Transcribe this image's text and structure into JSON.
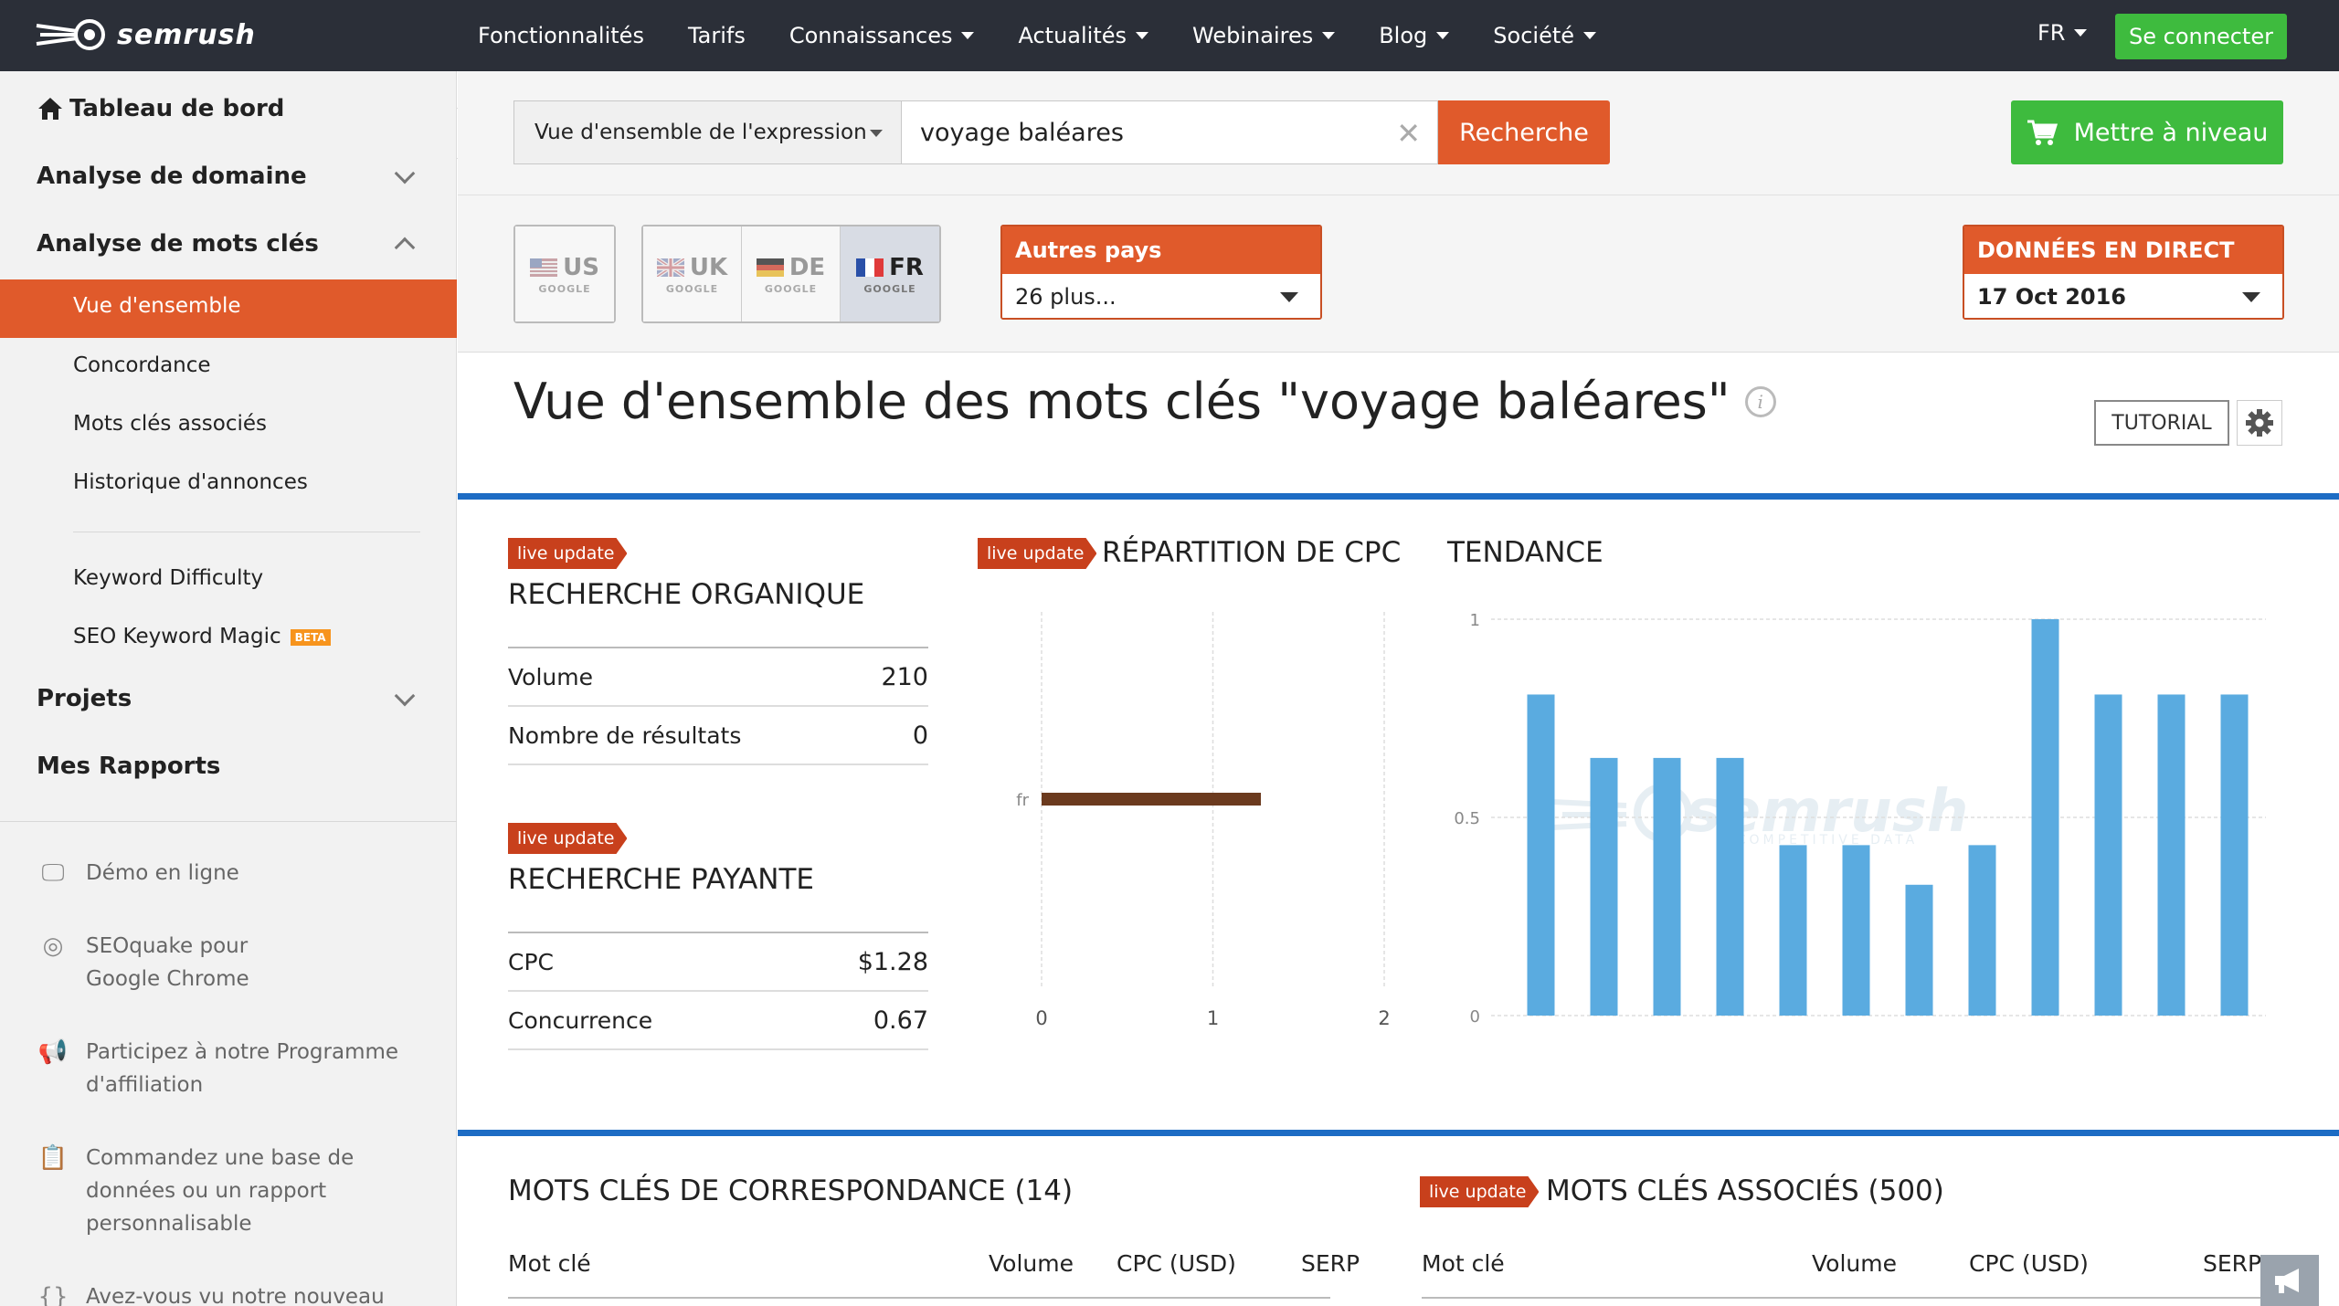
{
  "brand": {
    "name": "semrush"
  },
  "nav": {
    "items": [
      {
        "label": "Fonctionnalités",
        "dropdown": false
      },
      {
        "label": "Tarifs",
        "dropdown": false
      },
      {
        "label": "Connaissances",
        "dropdown": true
      },
      {
        "label": "Actualités",
        "dropdown": true
      },
      {
        "label": "Webinaires",
        "dropdown": true
      },
      {
        "label": "Blog",
        "dropdown": true
      },
      {
        "label": "Société",
        "dropdown": true
      }
    ],
    "language": "FR",
    "login_label": "Se connecter"
  },
  "sidebar": {
    "dashboard": "Tableau de bord",
    "domain_analysis": "Analyse de domaine",
    "keyword_analysis": "Analyse de mots clés",
    "sub_items": [
      "Vue d'ensemble",
      "Concordance",
      "Mots clés associés",
      "Historique d'annonces"
    ],
    "extra_items": [
      "Keyword Difficulty",
      "SEO Keyword Magic"
    ],
    "beta_label": "BETA",
    "projects": "Projets",
    "reports": "Mes Rapports",
    "links": [
      {
        "icon": "monitor-icon",
        "lines": [
          "Démo en ligne"
        ]
      },
      {
        "icon": "chrome-icon",
        "lines": [
          "SEOquake pour",
          "Google Chrome"
        ]
      },
      {
        "icon": "megaphone-icon",
        "lines": [
          "Participez à notre Programme",
          "d'affiliation"
        ]
      },
      {
        "icon": "clipboard-icon",
        "lines": [
          "Commandez une base de",
          "données ou un rapport",
          "personnalisable"
        ]
      },
      {
        "icon": "braces-icon",
        "lines": [
          "Avez-vous vu notre nouveau"
        ]
      }
    ]
  },
  "search": {
    "type_label": "Vue d'ensemble de l'expression",
    "query": "voyage baléares",
    "button": "Recherche",
    "upgrade": "Mettre à niveau"
  },
  "databases": {
    "google_label": "GOOGLE",
    "us": "US",
    "group": [
      "UK",
      "DE",
      "FR"
    ],
    "active": "FR",
    "other_title": "Autres pays",
    "other_value": "26 plus...",
    "live_title": "DONNÉES EN DIRECT",
    "live_date": "17 Oct 2016"
  },
  "page": {
    "title": "Vue d'ensemble des mots clés \"voyage baléares\"",
    "tutorial": "TUTORIAL",
    "live_update": "live update"
  },
  "organic": {
    "title": "RECHERCHE ORGANIQUE",
    "rows": [
      {
        "label": "Volume",
        "value": "210"
      },
      {
        "label": "Nombre de résultats",
        "value": "0"
      }
    ]
  },
  "paid": {
    "title": "RECHERCHE PAYANTE",
    "rows": [
      {
        "label": "CPC",
        "value": "$1.28"
      },
      {
        "label": "Concurrence",
        "value": "0.67"
      }
    ]
  },
  "cpc_chart_title": "RÉPARTITION DE CPC",
  "trend_chart_title": "TENDANCE",
  "watermark": {
    "brand": "semrush",
    "tagline": "COMPETITIVE DATA"
  },
  "chart_data": [
    {
      "type": "bar",
      "orientation": "horizontal",
      "title": "RÉPARTITION DE CPC",
      "categories": [
        "fr"
      ],
      "values": [
        1.28
      ],
      "xlim": [
        0,
        2
      ],
      "xticks": [
        "0",
        "1",
        "2"
      ],
      "grid": true,
      "color": "#6b3a1e"
    },
    {
      "type": "bar",
      "title": "TENDANCE",
      "values": [
        0.81,
        0.65,
        0.65,
        0.65,
        0.43,
        0.43,
        0.33,
        0.43,
        1.0,
        0.81,
        0.81,
        0.81
      ],
      "ylim": [
        0,
        1
      ],
      "yticks": [
        "0",
        "0.5",
        "1"
      ],
      "grid": true,
      "color": "#5aabe0"
    }
  ],
  "match_table": {
    "title": "MOTS CLÉS DE CORRESPONDANCE (14)",
    "columns": [
      "Mot clé",
      "Volume",
      "CPC (USD)",
      "SERP"
    ]
  },
  "related_table": {
    "title": "MOTS CLÉS ASSOCIÉS (500)",
    "columns": [
      "Mot clé",
      "Volume",
      "CPC (USD)",
      "SERP"
    ]
  },
  "colors": {
    "accent": "#e05a2b",
    "green": "#3ebb3e",
    "blue_rule": "#1d6cc4",
    "nav_bg": "#2b2f38"
  }
}
